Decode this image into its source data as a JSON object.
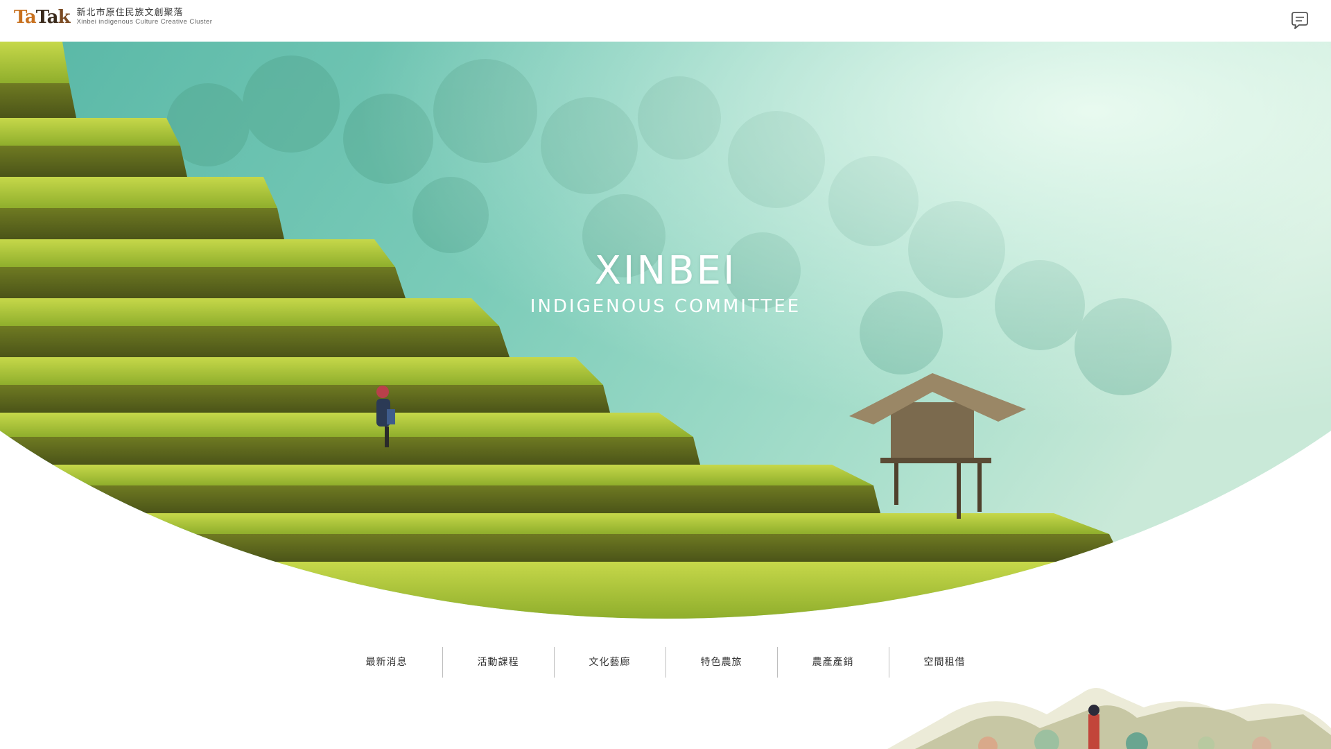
{
  "header": {
    "logo": {
      "word_parts": [
        "Ta",
        "Ta",
        "k"
      ],
      "name_cn": "新北市原住民族文創聚落",
      "name_en": "Xinbei indigenous Culture Creative Cluster"
    },
    "chat_icon": "chat-bubble-icon"
  },
  "hero": {
    "title": "XINBEI",
    "subtitle": "INDIGENOUS COMMITTEE"
  },
  "nav": {
    "items": [
      {
        "label": "最新消息"
      },
      {
        "label": "活動課程"
      },
      {
        "label": "文化藝廊"
      },
      {
        "label": "特色農旅"
      },
      {
        "label": "農產產銷"
      },
      {
        "label": "空間租借"
      }
    ]
  },
  "colors": {
    "accent_orange": "#c8711f",
    "text_dark": "#333333",
    "separator": "#bdbdbd",
    "sky_teal": "#6fc9b8",
    "rice_green": "#a7c63a"
  }
}
